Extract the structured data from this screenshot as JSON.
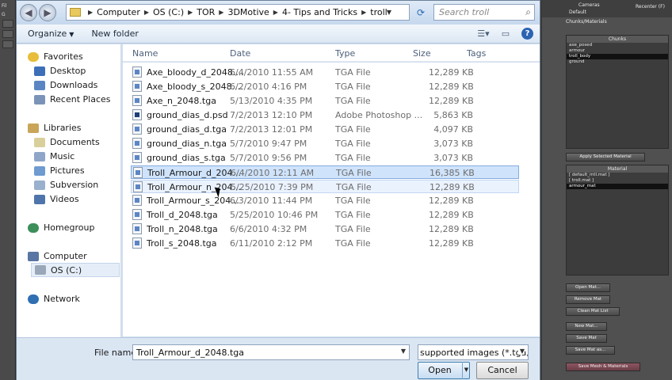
{
  "address": {
    "breadcrumbs": [
      "Computer",
      "OS (C:)",
      "TOR",
      "3DMotive",
      "4- Tips and Tricks",
      "troll"
    ],
    "search_placeholder": "Search troll"
  },
  "toolbar": {
    "organize_label": "Organize",
    "new_folder_label": "New folder"
  },
  "nav": {
    "favorites": "Favorites",
    "desktop": "Desktop",
    "downloads": "Downloads",
    "recent_places": "Recent Places",
    "libraries": "Libraries",
    "documents": "Documents",
    "music": "Music",
    "pictures": "Pictures",
    "subversion": "Subversion",
    "videos": "Videos",
    "homegroup": "Homegroup",
    "computer": "Computer",
    "os_c": "OS (C:)",
    "network": "Network"
  },
  "columns": {
    "name": "Name",
    "date": "Date",
    "type": "Type",
    "size": "Size",
    "tags": "Tags"
  },
  "files": [
    {
      "name": "Axe_bloody_d_2048....",
      "date": "6/4/2010 11:55 AM",
      "type": "TGA File",
      "size": "12,289 KB"
    },
    {
      "name": "Axe_bloody_s_2048....",
      "date": "6/2/2010 4:16 PM",
      "type": "TGA File",
      "size": "12,289 KB"
    },
    {
      "name": "Axe_n_2048.tga",
      "date": "5/13/2010 4:35 PM",
      "type": "TGA File",
      "size": "12,289 KB"
    },
    {
      "name": "ground_dias_d.psd",
      "date": "7/2/2013 12:10 PM",
      "type": "Adobe Photoshop ...",
      "size": "5,863 KB"
    },
    {
      "name": "ground_dias_d.tga",
      "date": "7/2/2013 12:01 PM",
      "type": "TGA File",
      "size": "4,097 KB"
    },
    {
      "name": "ground_dias_n.tga",
      "date": "5/7/2010 9:47 PM",
      "type": "TGA File",
      "size": "3,073 KB"
    },
    {
      "name": "ground_dias_s.tga",
      "date": "5/7/2010 9:56 PM",
      "type": "TGA File",
      "size": "3,073 KB"
    },
    {
      "name": "Troll_Armour_d_204...",
      "date": "6/4/2010 12:11 AM",
      "type": "TGA File",
      "size": "16,385 KB"
    },
    {
      "name": "Troll_Armour_n_204...",
      "date": "5/25/2010 7:39 PM",
      "type": "TGA File",
      "size": "12,289 KB"
    },
    {
      "name": "Troll_Armour_s_204...",
      "date": "6/3/2010 11:44 PM",
      "type": "TGA File",
      "size": "12,289 KB"
    },
    {
      "name": "Troll_d_2048.tga",
      "date": "5/25/2010 10:46 PM",
      "type": "TGA File",
      "size": "12,289 KB"
    },
    {
      "name": "Troll_n_2048.tga",
      "date": "6/6/2010 4:32 PM",
      "type": "TGA File",
      "size": "12,289 KB"
    },
    {
      "name": "Troll_s_2048.tga",
      "date": "6/11/2010 2:12 PM",
      "type": "TGA File",
      "size": "12,289 KB"
    }
  ],
  "footer": {
    "file_name_label": "File name:",
    "file_name_value": "Troll_Armour_d_2048.tga",
    "file_type_value": "supported images (*.tga,*.dc",
    "open_label": "Open",
    "cancel_label": "Cancel"
  },
  "app_panel": {
    "cameras_label": "Cameras",
    "default_label": "Default",
    "recenter_label": "Recenter (F)",
    "tab_label": "Chunks/Materials",
    "chunks_title": "Chunks",
    "chunks": [
      "axe_posed",
      "armour",
      "troll_body",
      "ground"
    ],
    "apply_label": "Apply Selected Material",
    "material_title": "Material",
    "materials": [
      "[ default_mtl.mat ]",
      "[ troll.mat ]",
      "armour_mat"
    ],
    "open_mat": "Open Mat...",
    "remove_mat": "Remove Mat",
    "clean_mat_list": "Clean Mat List",
    "new_mat": "New Mat...",
    "save_mat": "Save Mat",
    "save_mat_as": "Save Mat as...",
    "save_mesh_materials": "Save Mesh & Materials"
  },
  "left_strip": {
    "labels": [
      "Fil",
      "G"
    ]
  }
}
